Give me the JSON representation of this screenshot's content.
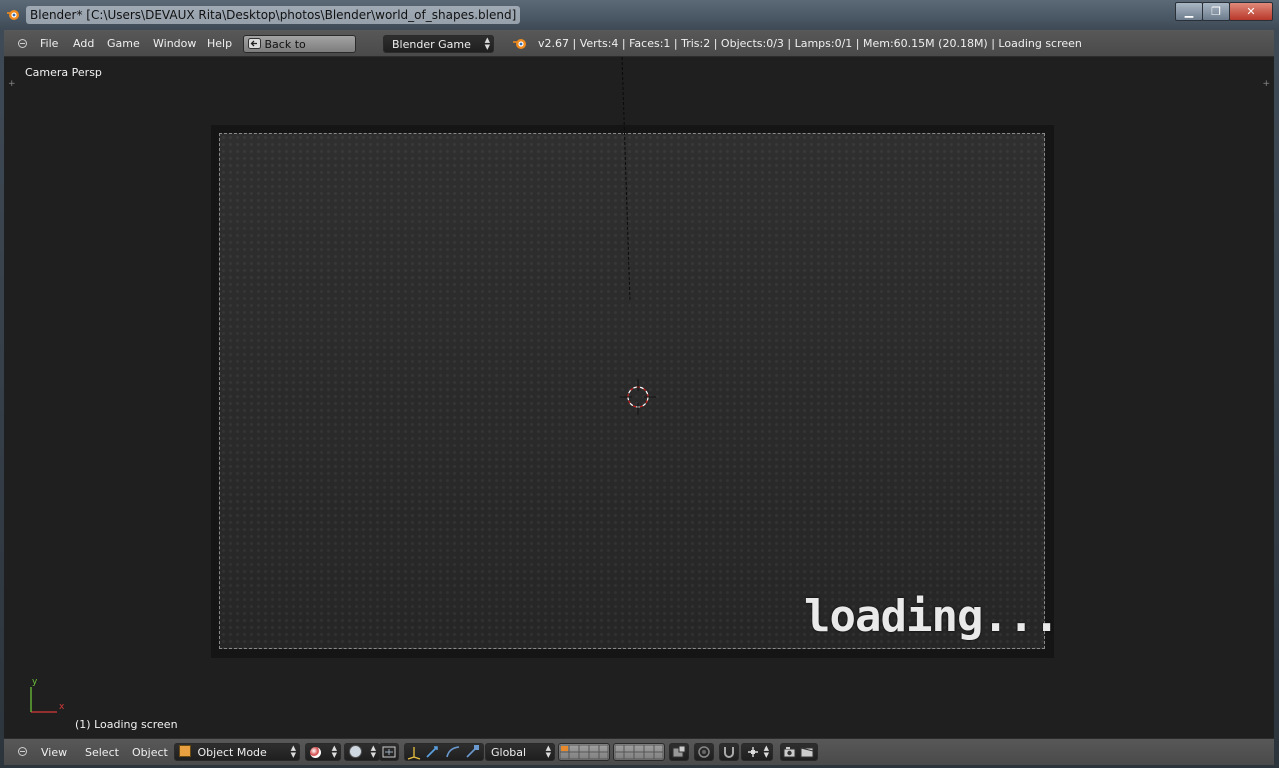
{
  "window": {
    "title": "Blender* [C:\\Users\\DEVAUX Rita\\Desktop\\photos\\Blender\\world_of_shapes.blend]",
    "minimize_symbol": "▁",
    "maximize_symbol": "❐",
    "close_symbol": "✕"
  },
  "header": {
    "menus": [
      "File",
      "Add",
      "Game",
      "Window",
      "Help"
    ],
    "back_button": "Back to Previous",
    "engine": "Blender Game",
    "stats": "v2.67 | Verts:4 | Faces:1 | Tris:2 | Objects:0/3 | Lamps:0/1 | Mem:60.15M (20.18M) | Loading screen"
  },
  "viewport": {
    "view_label": "Camera Persp",
    "status": "(1) Loading screen",
    "overlay_text": "loading...",
    "axis_y": "y",
    "axis_x": "x"
  },
  "footer": {
    "menus": [
      "View",
      "Select",
      "Object"
    ],
    "mode": "Object Mode",
    "orientation": "Global"
  },
  "colors": {
    "viewport_bg": "#1f1f1f",
    "header_bg": "#4f4f4f",
    "axis_x": "#d83a3a",
    "axis_y": "#6cc23a"
  }
}
